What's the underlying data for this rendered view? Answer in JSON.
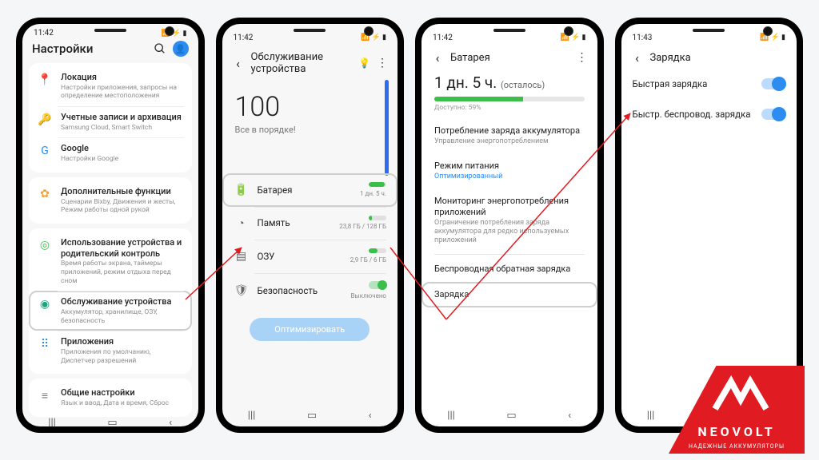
{
  "phone1": {
    "time": "11:42",
    "title": "Настройки",
    "groups": [
      [
        {
          "icon": "📍",
          "iconColor": "#3bbf4a",
          "title": "Локация",
          "sub": "Настройки приложения, запросы на определение местоположения"
        },
        {
          "icon": "🔑",
          "iconColor": "#a07340",
          "title": "Учетные записи и архивация",
          "sub": "Samsung Cloud, Smart Switch"
        },
        {
          "icon": "G",
          "iconColor": "#2d8cf0",
          "title": "Google",
          "sub": "Настройки Google"
        }
      ],
      [
        {
          "icon": "✿",
          "iconColor": "#f2a13a",
          "title": "Дополнительные функции",
          "sub": "Сценарии Bixby, Движения и жесты, Режим работы одной рукой"
        }
      ],
      [
        {
          "icon": "◎",
          "iconColor": "#3bbf4a",
          "title": "Использование устройства и родительский контроль",
          "sub": "Время работы экрана, таймеры приложений, режим отдыха перед сном"
        },
        {
          "icon": "◉",
          "iconColor": "#1aa57d",
          "title": "Обслуживание устройства",
          "sub": "Аккумулятор, хранилище, ОЗУ, безопасность",
          "hl": true
        },
        {
          "icon": "⠿",
          "iconColor": "#2d8cf0",
          "title": "Приложения",
          "sub": "Приложения по умолчанию, Диспетчер разрешений"
        }
      ],
      [
        {
          "icon": "≡",
          "iconColor": "#777",
          "title": "Общие настройки",
          "sub": "Язык и ввод, Дата и время, Сброс"
        }
      ]
    ]
  },
  "phone2": {
    "time": "11:42",
    "title": "Обслуживание устройства",
    "score": "100",
    "scoreText": "Все в порядке!",
    "items": [
      {
        "icon": "🔋",
        "label": "Батарея",
        "detail": "1 дн. 5 ч.",
        "bar": 90,
        "hl": true
      },
      {
        "icon": "◔",
        "label": "Память",
        "detail": "23,8 ГБ / 128 ГБ",
        "bar": 20
      },
      {
        "icon": "▤",
        "label": "ОЗУ",
        "detail": "2,9 ГБ / 6 ГБ",
        "bar": 50
      },
      {
        "icon": "🛡",
        "label": "Безопасность",
        "detail": "Выключено",
        "toggle": true
      }
    ],
    "optimize": "Оптимизировать"
  },
  "phone3": {
    "time": "11:42",
    "title": "Батарея",
    "remainValue": "1 дн. 5 ч.",
    "remainSuffix": "(осталось)",
    "availText": "Доступно: 59%",
    "list": [
      {
        "t": "Потребление заряда аккумулятора",
        "s": "Управление энергопотреблением"
      },
      {
        "t": "Режим питания",
        "s": "Оптимизированный",
        "link": true
      },
      {
        "t": "Мониторинг энергопотребления приложений",
        "s": "Ограничение потребления заряда аккумулятора для редко используемых приложений"
      },
      {
        "div": true
      },
      {
        "t": "Беспроводная обратная зарядка"
      },
      {
        "t": "Зарядка",
        "hl": true
      }
    ]
  },
  "phone4": {
    "time": "11:43",
    "title": "Зарядка",
    "toggles": [
      {
        "label": "Быстрая зарядка",
        "on": true
      },
      {
        "label": "Быстр. беспровод. зарядка",
        "on": true
      }
    ]
  },
  "logo": {
    "brand": "NEOVOLT",
    "tag": "НАДЕЖНЫЕ АККУМУЛЯТОРЫ"
  }
}
